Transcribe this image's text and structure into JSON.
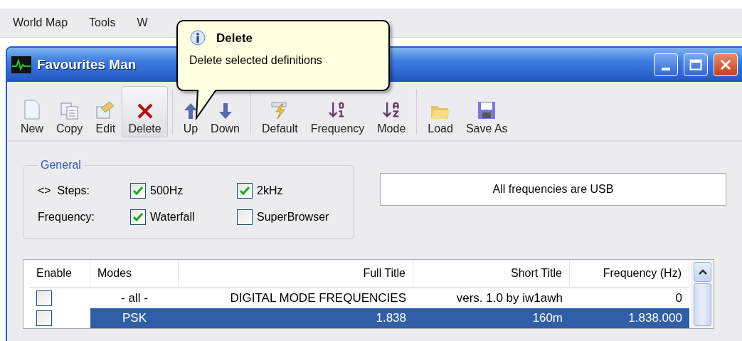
{
  "menu_bar": [
    "World Map",
    "Tools",
    "W"
  ],
  "window": {
    "title": "Favourites Man"
  },
  "tooltip": {
    "title": "Delete",
    "text": "Delete selected definitions"
  },
  "toolbar": [
    {
      "label": "New",
      "hovered": false
    },
    {
      "label": "Copy",
      "hovered": false
    },
    {
      "label": "Edit",
      "hovered": false
    },
    {
      "label": "Delete",
      "hovered": true
    },
    {
      "label": "Up",
      "hovered": false
    },
    {
      "label": "Down",
      "hovered": false
    },
    {
      "label": "Default",
      "hovered": false
    },
    {
      "label": "Frequency",
      "hovered": false
    },
    {
      "label": "Mode",
      "hovered": false
    },
    {
      "label": "Load",
      "hovered": false
    },
    {
      "label": "Save As",
      "hovered": false
    }
  ],
  "general": {
    "title": "General",
    "rows": [
      {
        "label": "<>  Steps:",
        "options": [
          {
            "label": "500Hz",
            "checked": true
          },
          {
            "label": "2kHz",
            "checked": true
          }
        ]
      },
      {
        "label": "Frequency:",
        "options": [
          {
            "label": "Waterfall",
            "checked": true
          },
          {
            "label": "SuperBrowser",
            "checked": false
          }
        ]
      }
    ]
  },
  "note": "All frequencies are USB",
  "table": {
    "columns": [
      "Enable",
      "Modes",
      "Full Title",
      "Short Title",
      "Frequency (Hz)"
    ],
    "rows": [
      {
        "enabled": false,
        "selected": false,
        "mode": "- all -",
        "full_title": "DIGITAL MODE FREQUENCIES",
        "short_title": "vers. 1.0 by iw1awh",
        "frequency": "0"
      },
      {
        "enabled": false,
        "selected": true,
        "mode": "PSK",
        "full_title": "1.838",
        "short_title": "160m",
        "frequency": "1.838.000"
      }
    ]
  }
}
